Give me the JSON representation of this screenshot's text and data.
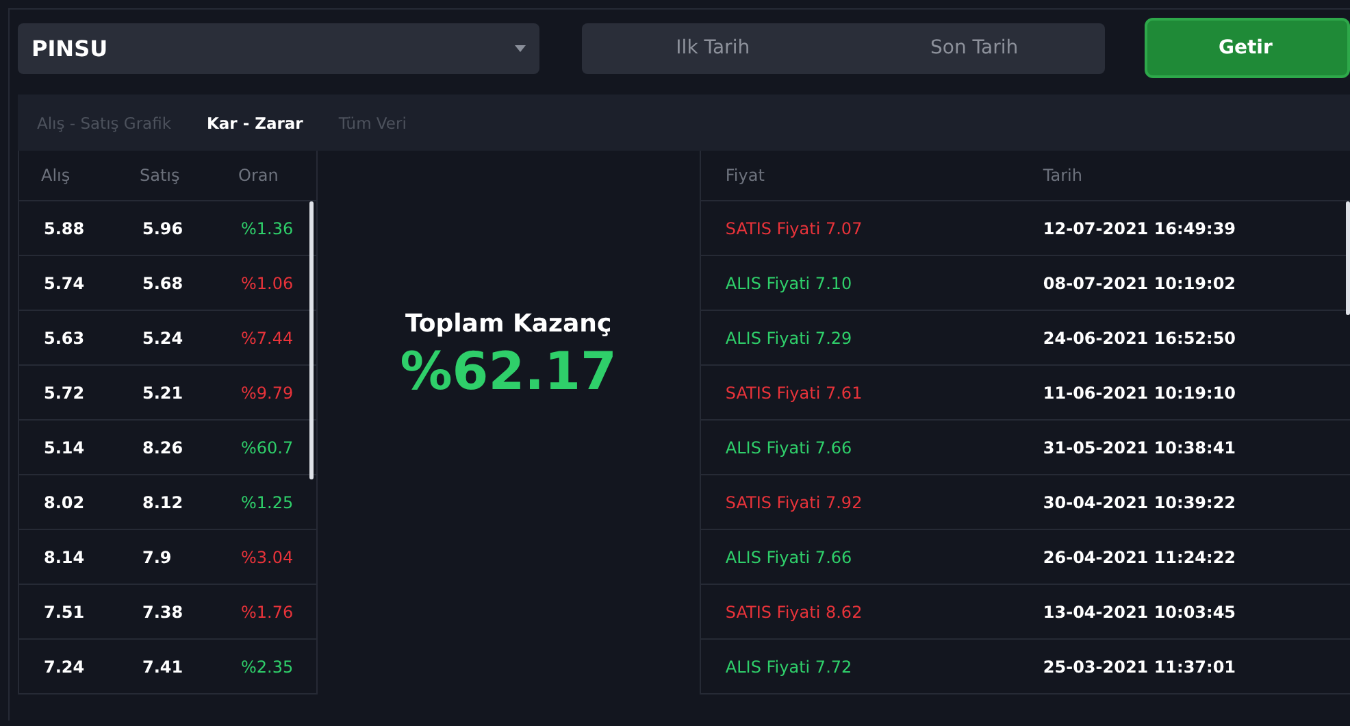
{
  "symbol_select": {
    "value": "PINSU"
  },
  "date_range": {
    "start_placeholder": "Ilk Tarih",
    "end_placeholder": "Son Tarih"
  },
  "fetch_button": "Getir",
  "tabs": [
    {
      "label": "Alış - Satış Grafik",
      "selected": false
    },
    {
      "label": "Kar - Zarar",
      "selected": true
    },
    {
      "label": "Tüm Veri",
      "selected": false
    }
  ],
  "trades_table": {
    "columns": [
      "Alış",
      "Satış",
      "Oran"
    ],
    "rows": [
      {
        "buy": "5.88",
        "sell": "5.96",
        "ratio": "%1.36",
        "kind": "gain"
      },
      {
        "buy": "5.74",
        "sell": "5.68",
        "ratio": "%1.06",
        "kind": "loss"
      },
      {
        "buy": "5.63",
        "sell": "5.24",
        "ratio": "%7.44",
        "kind": "loss"
      },
      {
        "buy": "5.72",
        "sell": "5.21",
        "ratio": "%9.79",
        "kind": "loss"
      },
      {
        "buy": "5.14",
        "sell": "8.26",
        "ratio": "%60.7",
        "kind": "gain"
      },
      {
        "buy": "8.02",
        "sell": "8.12",
        "ratio": "%1.25",
        "kind": "gain"
      },
      {
        "buy": "8.14",
        "sell": "7.9",
        "ratio": "%3.04",
        "kind": "loss"
      },
      {
        "buy": "7.51",
        "sell": "7.38",
        "ratio": "%1.76",
        "kind": "loss"
      },
      {
        "buy": "7.24",
        "sell": "7.41",
        "ratio": "%2.35",
        "kind": "gain"
      }
    ]
  },
  "total": {
    "label": "Toplam Kazanç",
    "value": "%62.17"
  },
  "orders_table": {
    "columns": [
      "Fiyat",
      "Tarih"
    ],
    "rows": [
      {
        "price": "SATIS Fiyati 7.07",
        "date": "12-07-2021 16:49:39",
        "kind": "sell"
      },
      {
        "price": "ALIS Fiyati 7.10",
        "date": "08-07-2021 10:19:02",
        "kind": "buy"
      },
      {
        "price": "ALIS Fiyati 7.29",
        "date": "24-06-2021 16:52:50",
        "kind": "buy"
      },
      {
        "price": "SATIS Fiyati 7.61",
        "date": "11-06-2021 10:19:10",
        "kind": "sell"
      },
      {
        "price": "ALIS Fiyati 7.66",
        "date": "31-05-2021 10:38:41",
        "kind": "buy"
      },
      {
        "price": "SATIS Fiyati 7.92",
        "date": "30-04-2021 10:39:22",
        "kind": "sell"
      },
      {
        "price": "ALIS Fiyati 7.66",
        "date": "26-04-2021 11:24:22",
        "kind": "buy"
      },
      {
        "price": "SATIS Fiyati 8.62",
        "date": "13-04-2021 10:03:45",
        "kind": "sell"
      },
      {
        "price": "ALIS Fiyati 7.72",
        "date": "25-03-2021 11:37:01",
        "kind": "buy"
      }
    ]
  }
}
